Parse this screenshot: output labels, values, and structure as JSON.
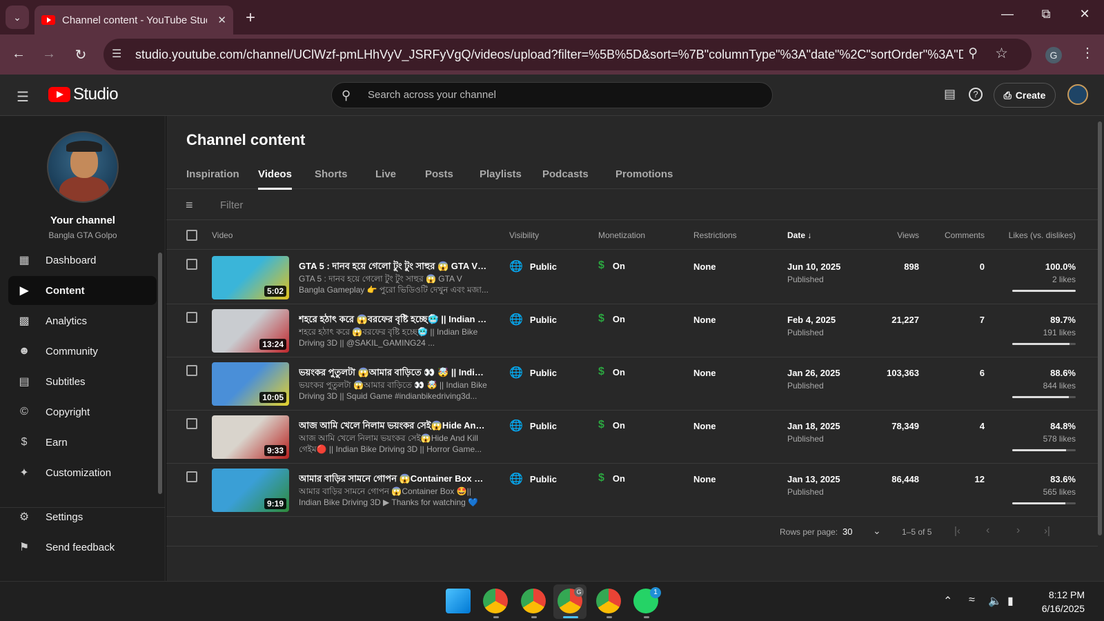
{
  "browser": {
    "tab_title": "Channel content - YouTube Studio",
    "url": "studio.youtube.com/channel/UClWzf-pmLHhVyV_JSRFyVgQ/videos/upload?filter=%5B%5D&sort=%7B\"columnType\"%3A\"date\"%2C\"sortOrder\"%3A\"DESC...",
    "profile_letter": "G"
  },
  "header": {
    "logo_text": "Studio",
    "search_placeholder": "Search across your channel",
    "create_label": "Create"
  },
  "sidebar": {
    "channel_title": "Your channel",
    "channel_name": "Bangla GTA Golpo",
    "items": [
      {
        "label": "Dashboard",
        "icon": "dashboard-icon"
      },
      {
        "label": "Content",
        "icon": "content-icon",
        "active": true
      },
      {
        "label": "Analytics",
        "icon": "analytics-icon"
      },
      {
        "label": "Community",
        "icon": "community-icon"
      },
      {
        "label": "Subtitles",
        "icon": "subtitles-icon"
      },
      {
        "label": "Copyright",
        "icon": "copyright-icon"
      },
      {
        "label": "Earn",
        "icon": "earn-icon"
      },
      {
        "label": "Customization",
        "icon": "customization-icon"
      }
    ],
    "bottom_items": [
      {
        "label": "Settings",
        "icon": "gear-icon"
      },
      {
        "label": "Send feedback",
        "icon": "feedback-icon"
      }
    ]
  },
  "main": {
    "title": "Channel content",
    "tabs": [
      "Inspiration",
      "Videos",
      "Shorts",
      "Live",
      "Posts",
      "Playlists",
      "Podcasts",
      "Promotions"
    ],
    "active_tab": "Videos",
    "filter_placeholder": "Filter",
    "columns": {
      "video": "Video",
      "visibility": "Visibility",
      "monetization": "Monetization",
      "restrictions": "Restrictions",
      "date": "Date",
      "views": "Views",
      "comments": "Comments",
      "likes": "Likes (vs. dislikes)"
    },
    "rows": [
      {
        "duration": "5:02",
        "title": "GTA 5 : দানব হয়ে গেলো টুং টুং সাহুর 😱 GTA V Bangla Gameplay",
        "description": "GTA 5 : দানব হয়ে গেলো টুং টুং সাহুর 😱 GTA V Bangla Gameplay 👉 পুরো ভিডিওটি দেখুন এবং মজা...",
        "visibility": "Public",
        "monetization": "On",
        "restrictions": "None",
        "date": "Jun 10, 2025",
        "status": "Published",
        "views": "898",
        "comments": "0",
        "likes_pct": "100.0%",
        "likes_count": "2 likes",
        "likes_fraction": 1.0,
        "thumb_colors": [
          "#3ab5d9",
          "#e3c21a"
        ]
      },
      {
        "duration": "13:24",
        "title": "শহরে হঠাৎ করে 😱বরফের বৃষ্টি হচ্ছে🥶 || Indian Bike Driving 3D",
        "description": "শহরে হঠাৎ করে 😱বরফের বৃষ্টি হচ্ছে🥶 || Indian Bike Driving 3D || @SAKIL_GAMING24 ...",
        "visibility": "Public",
        "monetization": "On",
        "restrictions": "None",
        "date": "Feb 4, 2025",
        "status": "Published",
        "views": "21,227",
        "comments": "7",
        "likes_pct": "89.7%",
        "likes_count": "191 likes",
        "likes_fraction": 0.897,
        "thumb_colors": [
          "#c9ccd0",
          "#c0262b"
        ]
      },
      {
        "duration": "10:05",
        "title": "ভয়ংকর পুতুলটা 😱আমার বাড়িতে 👀 🤯 || Indian Bike Driving 3D",
        "description": "ভয়ংকর পুতুলটা 😱আমার বাড়িতে 👀 🤯 || Indian Bike Driving 3D || Squid Game #indianbikedriving3d...",
        "visibility": "Public",
        "monetization": "On",
        "restrictions": "None",
        "date": "Jan 26, 2025",
        "status": "Published",
        "views": "103,363",
        "comments": "6",
        "likes_pct": "88.6%",
        "likes_count": "844 likes",
        "likes_fraction": 0.886,
        "thumb_colors": [
          "#4a8fd8",
          "#e6d22a"
        ]
      },
      {
        "duration": "9:33",
        "title": "আজ আমি খেলে নিলাম ভয়ংকর সেই😱Hide And Kill গেইম",
        "description": "আজ আমি খেলে নিলাম ভয়ংকর সেই😱Hide And Kill গেইম🔴 || Indian Bike Driving 3D || Horror Game...",
        "visibility": "Public",
        "monetization": "On",
        "restrictions": "None",
        "date": "Jan 18, 2025",
        "status": "Published",
        "views": "78,349",
        "comments": "4",
        "likes_pct": "84.8%",
        "likes_count": "578 likes",
        "likes_fraction": 0.848,
        "thumb_colors": [
          "#d9d4cc",
          "#b8201e"
        ]
      },
      {
        "duration": "9:19",
        "title": "আমার বাড়ির সামনে গোপন 😱Container Box 🤩|| Indian Bike Driving 3D",
        "description": "আমার বাড়ির সামনে গোপন 😱Container Box 🤩|| Indian Bike Driving 3D ▶ Thanks for watching 💙 ▶...",
        "visibility": "Public",
        "monetization": "On",
        "restrictions": "None",
        "date": "Jan 13, 2025",
        "status": "Published",
        "views": "86,448",
        "comments": "12",
        "likes_pct": "83.6%",
        "likes_count": "565 likes",
        "likes_fraction": 0.836,
        "thumb_colors": [
          "#3a9fd6",
          "#2f8a3a"
        ]
      }
    ],
    "pagination": {
      "rows_per_page_label": "Rows per page:",
      "rows_per_page": "30",
      "range": "1–5 of 5"
    }
  },
  "taskbar": {
    "time": "8:12 PM",
    "date": "6/16/2025",
    "whatsapp_badge": "1",
    "chrome_profile_badge": "G"
  },
  "colors": {
    "accent_red": "#ff0000",
    "monetization_green": "#2ba640",
    "tab_strip": "#3c1c27",
    "toolbar": "#5a3140"
  }
}
